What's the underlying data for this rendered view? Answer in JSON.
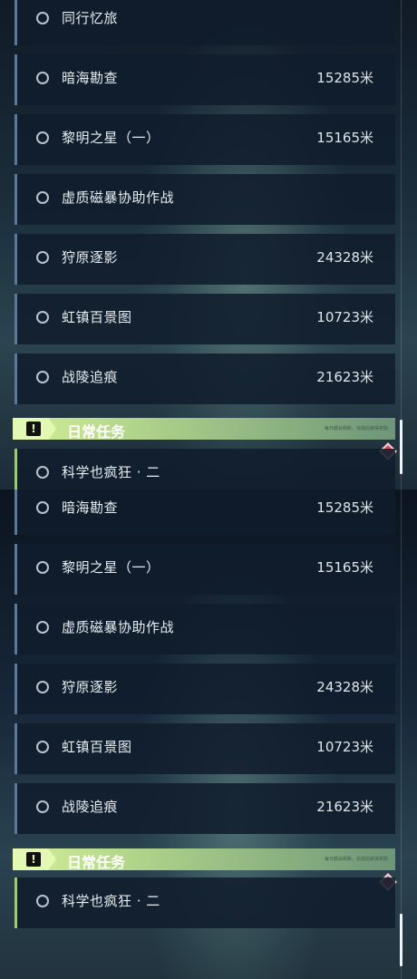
{
  "header": {
    "title": "日常任务",
    "icon": "exclamation-icon",
    "fine_print": "每日都会刷新，完成后获得奖励"
  },
  "panel1": {
    "tasks": [
      {
        "name": "同行忆旅",
        "distance": ""
      },
      {
        "name": "暗海勘查",
        "distance": "15285米"
      },
      {
        "name": "黎明之星（一）",
        "distance": "15165米"
      },
      {
        "name": "虚质磁暴协助作战",
        "distance": ""
      },
      {
        "name": "狩原逐影",
        "distance": "24328米"
      },
      {
        "name": "虹镇百景图",
        "distance": "10723米"
      },
      {
        "name": "战陵追痕",
        "distance": "21623米"
      }
    ],
    "daily": [
      {
        "name": "科学也疯狂 · 二"
      }
    ]
  },
  "panel2": {
    "tasks": [
      {
        "name": "暗海勘查",
        "distance": "15285米"
      },
      {
        "name": "黎明之星（一）",
        "distance": "15165米"
      },
      {
        "name": "虚质磁暴协助作战",
        "distance": ""
      },
      {
        "name": "狩原逐影",
        "distance": "24328米"
      },
      {
        "name": "虹镇百景图",
        "distance": "10723米"
      },
      {
        "name": "战陵追痕",
        "distance": "21623米"
      }
    ],
    "daily": [
      {
        "name": "科学也疯狂 · 二"
      }
    ]
  },
  "colors": {
    "accent_green": "#c9ec8e",
    "marker_red": "#d4525c",
    "row_bg": "#101c2c"
  }
}
